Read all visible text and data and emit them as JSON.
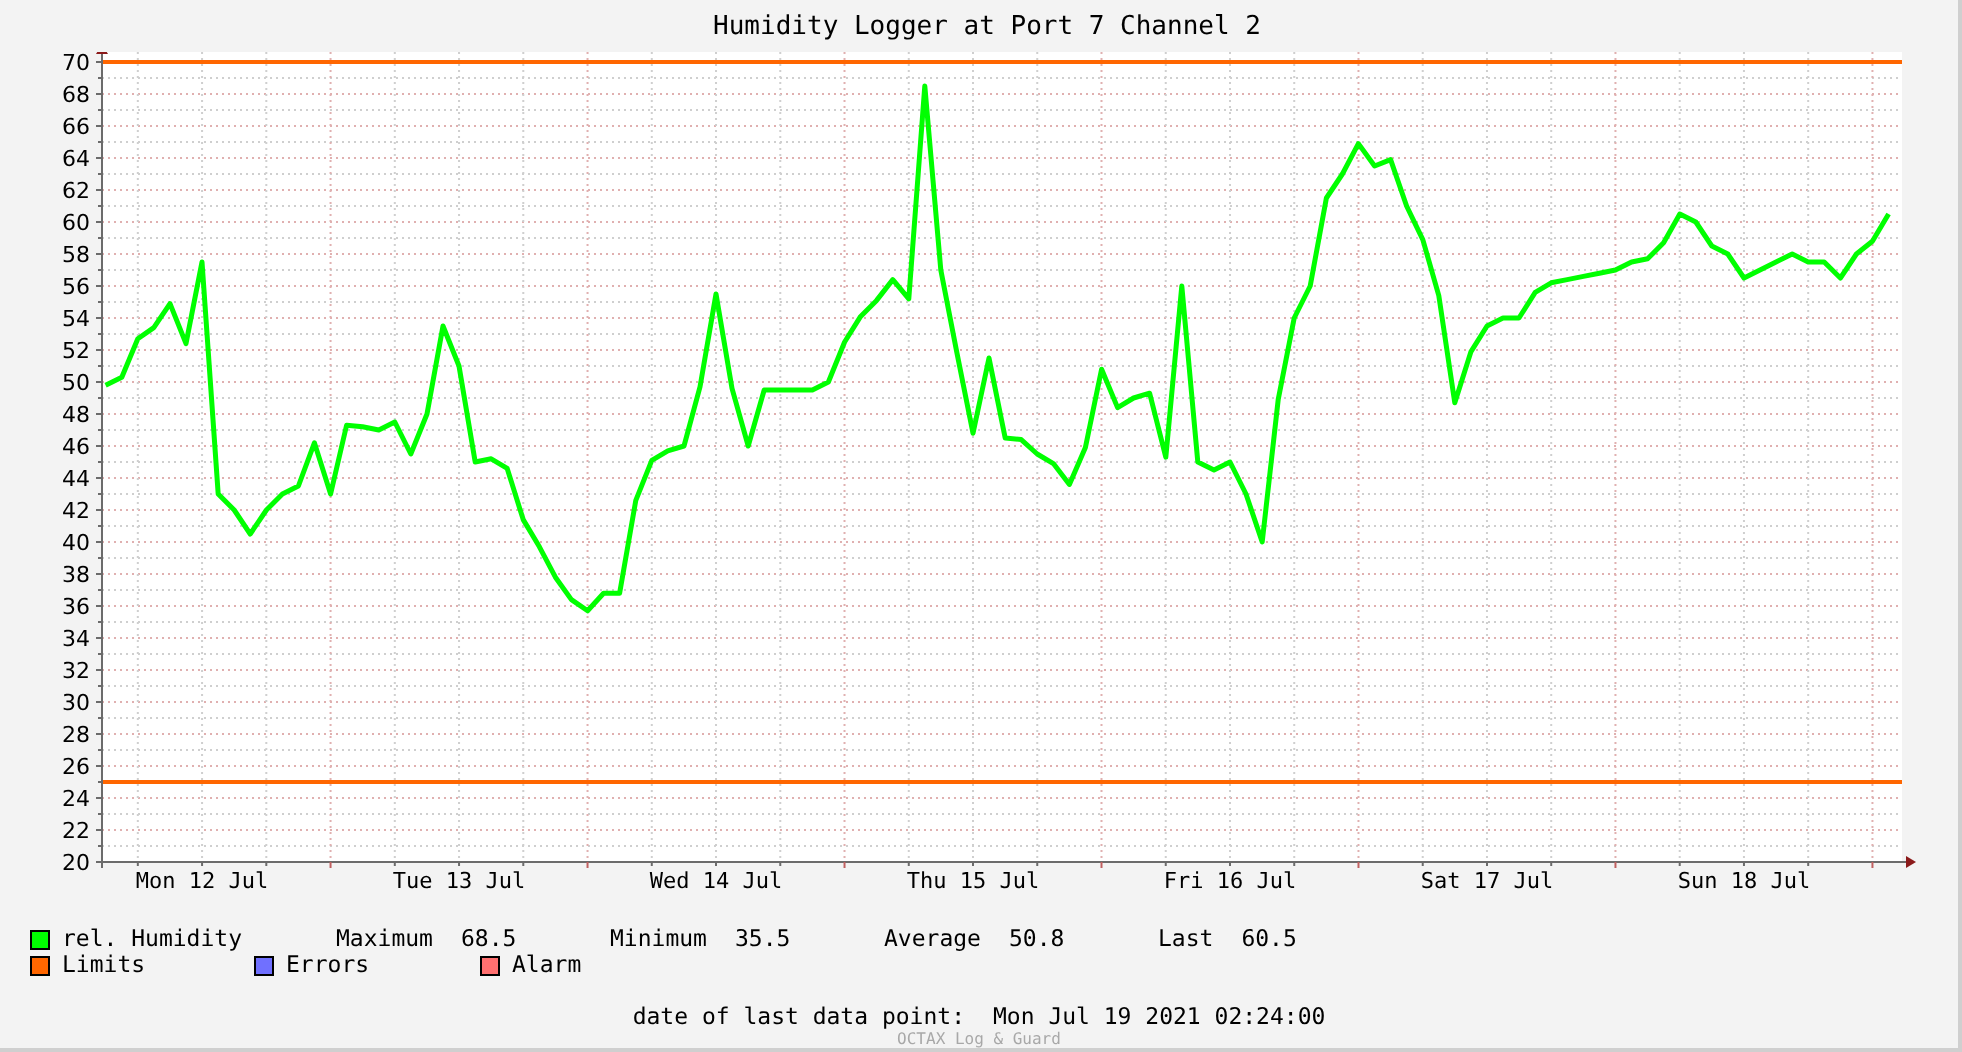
{
  "title": "Humidity Logger at Port 7 Channel 2",
  "chart": {
    "chart_data": {
      "type": "line",
      "grid": true,
      "ylim": [
        20,
        70
      ],
      "yticks": [
        20,
        22,
        24,
        26,
        28,
        30,
        32,
        34,
        36,
        38,
        40,
        42,
        44,
        46,
        48,
        50,
        52,
        54,
        56,
        58,
        60,
        62,
        64,
        66,
        68,
        70
      ],
      "categories": [
        null,
        null,
        null,
        null,
        null,
        null,
        "Mon 12 Jul",
        null,
        null,
        null,
        null,
        null,
        null,
        null,
        null,
        null,
        null,
        null,
        null,
        null,
        null,
        null,
        "Tue 13 Jul",
        null,
        null,
        null,
        null,
        null,
        null,
        null,
        null,
        null,
        null,
        null,
        null,
        null,
        null,
        null,
        "Wed 14 Jul",
        null,
        null,
        null,
        null,
        null,
        null,
        null,
        null,
        null,
        null,
        null,
        null,
        null,
        null,
        null,
        "Thu 15 Jul",
        null,
        null,
        null,
        null,
        null,
        null,
        null,
        null,
        null,
        null,
        null,
        null,
        null,
        null,
        null,
        "Fri 16 Jul",
        null,
        null,
        null,
        null,
        null,
        null,
        null,
        null,
        null,
        null,
        null,
        null,
        null,
        null,
        null,
        "Sat 17 Jul",
        null,
        null,
        null,
        null,
        null,
        null,
        null,
        null,
        null,
        null,
        null,
        null,
        null,
        null,
        null,
        "Sun 18 Jul",
        null,
        null,
        null,
        null,
        null,
        null,
        null,
        null,
        null
      ],
      "series": [
        {
          "name": "rel. Humidity",
          "color": "#00ff00",
          "values": [
            49.8,
            50.3,
            52.7,
            53.4,
            54.9,
            52.4,
            57.5,
            43,
            42,
            40.5,
            42,
            43,
            43.5,
            46.2,
            43,
            47.3,
            47.2,
            47,
            47.5,
            45.5,
            48,
            53.5,
            51,
            45,
            45.2,
            44.6,
            41.4,
            39.7,
            37.8,
            36.4,
            35.7,
            36.8,
            36.8,
            42.6,
            45.1,
            45.7,
            46,
            49.7,
            55.5,
            49.6,
            46,
            49.5,
            49.5,
            49.5,
            49.5,
            50,
            52.5,
            54.1,
            55.1,
            56.4,
            55.2,
            68.5,
            57,
            51.8,
            46.8,
            51.5,
            46.5,
            46.4,
            45.5,
            44.9,
            43.6,
            45.9,
            50.8,
            48.4,
            49,
            49.3,
            45.3,
            56,
            45,
            44.5,
            45,
            43,
            40,
            48.9,
            54,
            56,
            61.5,
            63,
            64.9,
            63.5,
            63.9,
            61,
            58.9,
            55.4,
            48.7,
            51.9,
            53.5,
            54,
            54,
            55.6,
            56.2,
            56.4,
            56.6,
            56.8,
            57,
            57.5,
            57.7,
            58.7,
            60.5,
            60,
            58.5,
            58,
            56.5,
            57,
            57.5,
            58,
            57.5,
            57.5,
            56.5,
            58,
            58.8,
            60.5
          ]
        }
      ],
      "ref_lines": [
        {
          "value": 70,
          "axis": "y",
          "color": "#ff6600"
        },
        {
          "value": 25,
          "axis": "y",
          "color": "#ff6600"
        }
      ]
    }
  },
  "legend": [
    {
      "label": "Limits",
      "color": "#ff6600"
    },
    {
      "label": "Errors",
      "color": "#7070ff"
    },
    {
      "label": "Alarm",
      "color": "#ff7070"
    }
  ],
  "stats": [
    {
      "label": "Maximum",
      "value": "68.5"
    },
    {
      "label": "Minimum",
      "value": "35.5"
    },
    {
      "label": "Average",
      "value": "50.8"
    },
    {
      "label": "Last",
      "value": "60.5"
    }
  ],
  "last_data_point": {
    "label": "date of last data point:",
    "value": "Mon Jul 19 2021 02:24:00"
  },
  "credit": "OCTAX Log & Guard"
}
